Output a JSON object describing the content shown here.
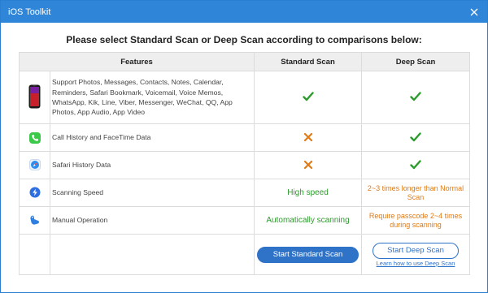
{
  "window": {
    "title": "iOS Toolkit"
  },
  "heading": "Please select Standard Scan or Deep Scan according to comparisons below:",
  "columns": {
    "features": "Features",
    "standard": "Standard Scan",
    "deep": "Deep Scan"
  },
  "rows": [
    {
      "icon": "iphone-icon",
      "feature": "Support Photos, Messages, Contacts, Notes, Calendar, Reminders, Safari Bookmark, Voicemail, Voice Memos, WhatsApp, Kik, Line, Viber, Messenger, WeChat, QQ, App Photos, App Audio, App Video",
      "standard": "check",
      "deep": "check"
    },
    {
      "icon": "phone-icon",
      "feature": "Call History and FaceTime Data",
      "standard": "cross",
      "deep": "check"
    },
    {
      "icon": "safari-icon",
      "feature": "Safari History Data",
      "standard": "cross",
      "deep": "check"
    },
    {
      "icon": "speed-icon",
      "feature": "Scanning Speed",
      "standard_text": "High speed",
      "deep_text": "2~3 times longer than Normal Scan"
    },
    {
      "icon": "hand-icon",
      "feature": "Manual Operation",
      "standard_text": "Automatically scanning",
      "deep_text": "Require passcode 2~4 times during scanning"
    }
  ],
  "buttons": {
    "standard": "Start Standard Scan",
    "deep": "Start Deep Scan",
    "learn_link": "Learn how to use Deep Scan"
  },
  "colors": {
    "titlebar": "#2f86d8",
    "check": "#2c9a2c",
    "cross": "#e07a16",
    "button": "#2f73c8"
  }
}
